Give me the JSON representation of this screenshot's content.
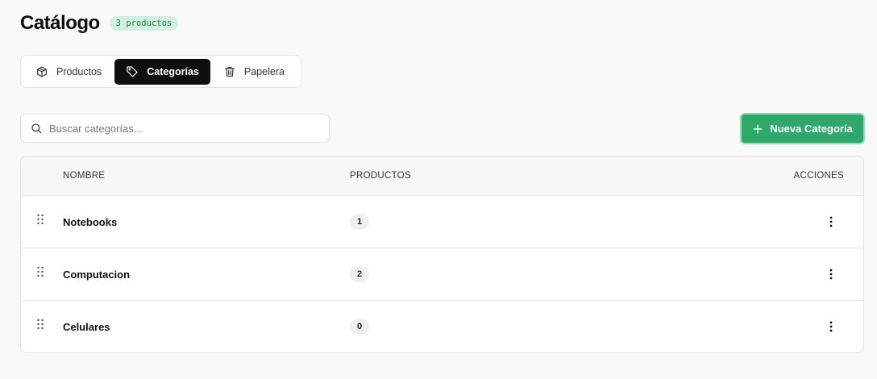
{
  "header": {
    "title": "Catálogo",
    "badge": "3 productos"
  },
  "tabs": [
    {
      "label": "Productos",
      "icon": "package-icon",
      "active": false
    },
    {
      "label": "Categorías",
      "icon": "tag-icon",
      "active": true
    },
    {
      "label": "Papelera",
      "icon": "trash-icon",
      "active": false
    }
  ],
  "search": {
    "placeholder": "Buscar categorías...",
    "value": ""
  },
  "new_button": {
    "label": "Nueva Categoría"
  },
  "table": {
    "columns": [
      "NOMBRE",
      "PRODUCTOS",
      "ACCIONES"
    ],
    "rows": [
      {
        "name": "Notebooks",
        "products": "1"
      },
      {
        "name": "Computacion",
        "products": "2"
      },
      {
        "name": "Celulares",
        "products": "0"
      }
    ]
  },
  "colors": {
    "accent": "#2fa86b",
    "badge_bg": "#d3f0df",
    "badge_text": "#1d7a4b",
    "active_tab": "#0f0f10"
  }
}
